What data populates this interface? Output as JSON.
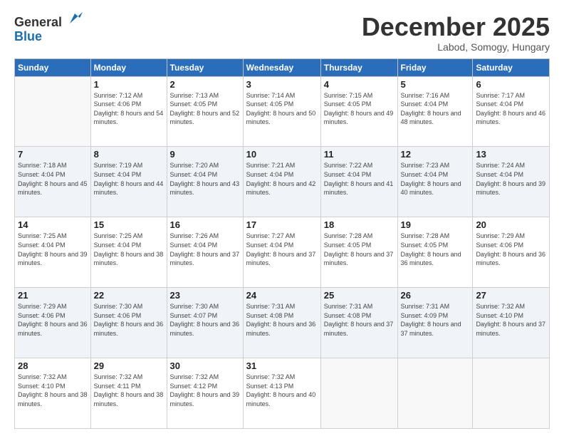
{
  "logo": {
    "general": "General",
    "blue": "Blue"
  },
  "header": {
    "month": "December 2025",
    "location": "Labod, Somogy, Hungary"
  },
  "weekdays": [
    "Sunday",
    "Monday",
    "Tuesday",
    "Wednesday",
    "Thursday",
    "Friday",
    "Saturday"
  ],
  "weeks": [
    [
      {
        "day": "",
        "sunrise": "",
        "sunset": "",
        "daylight": ""
      },
      {
        "day": "1",
        "sunrise": "Sunrise: 7:12 AM",
        "sunset": "Sunset: 4:06 PM",
        "daylight": "Daylight: 8 hours and 54 minutes."
      },
      {
        "day": "2",
        "sunrise": "Sunrise: 7:13 AM",
        "sunset": "Sunset: 4:05 PM",
        "daylight": "Daylight: 8 hours and 52 minutes."
      },
      {
        "day": "3",
        "sunrise": "Sunrise: 7:14 AM",
        "sunset": "Sunset: 4:05 PM",
        "daylight": "Daylight: 8 hours and 50 minutes."
      },
      {
        "day": "4",
        "sunrise": "Sunrise: 7:15 AM",
        "sunset": "Sunset: 4:05 PM",
        "daylight": "Daylight: 8 hours and 49 minutes."
      },
      {
        "day": "5",
        "sunrise": "Sunrise: 7:16 AM",
        "sunset": "Sunset: 4:04 PM",
        "daylight": "Daylight: 8 hours and 48 minutes."
      },
      {
        "day": "6",
        "sunrise": "Sunrise: 7:17 AM",
        "sunset": "Sunset: 4:04 PM",
        "daylight": "Daylight: 8 hours and 46 minutes."
      }
    ],
    [
      {
        "day": "7",
        "sunrise": "Sunrise: 7:18 AM",
        "sunset": "Sunset: 4:04 PM",
        "daylight": "Daylight: 8 hours and 45 minutes."
      },
      {
        "day": "8",
        "sunrise": "Sunrise: 7:19 AM",
        "sunset": "Sunset: 4:04 PM",
        "daylight": "Daylight: 8 hours and 44 minutes."
      },
      {
        "day": "9",
        "sunrise": "Sunrise: 7:20 AM",
        "sunset": "Sunset: 4:04 PM",
        "daylight": "Daylight: 8 hours and 43 minutes."
      },
      {
        "day": "10",
        "sunrise": "Sunrise: 7:21 AM",
        "sunset": "Sunset: 4:04 PM",
        "daylight": "Daylight: 8 hours and 42 minutes."
      },
      {
        "day": "11",
        "sunrise": "Sunrise: 7:22 AM",
        "sunset": "Sunset: 4:04 PM",
        "daylight": "Daylight: 8 hours and 41 minutes."
      },
      {
        "day": "12",
        "sunrise": "Sunrise: 7:23 AM",
        "sunset": "Sunset: 4:04 PM",
        "daylight": "Daylight: 8 hours and 40 minutes."
      },
      {
        "day": "13",
        "sunrise": "Sunrise: 7:24 AM",
        "sunset": "Sunset: 4:04 PM",
        "daylight": "Daylight: 8 hours and 39 minutes."
      }
    ],
    [
      {
        "day": "14",
        "sunrise": "Sunrise: 7:25 AM",
        "sunset": "Sunset: 4:04 PM",
        "daylight": "Daylight: 8 hours and 39 minutes."
      },
      {
        "day": "15",
        "sunrise": "Sunrise: 7:25 AM",
        "sunset": "Sunset: 4:04 PM",
        "daylight": "Daylight: 8 hours and 38 minutes."
      },
      {
        "day": "16",
        "sunrise": "Sunrise: 7:26 AM",
        "sunset": "Sunset: 4:04 PM",
        "daylight": "Daylight: 8 hours and 37 minutes."
      },
      {
        "day": "17",
        "sunrise": "Sunrise: 7:27 AM",
        "sunset": "Sunset: 4:04 PM",
        "daylight": "Daylight: 8 hours and 37 minutes."
      },
      {
        "day": "18",
        "sunrise": "Sunrise: 7:28 AM",
        "sunset": "Sunset: 4:05 PM",
        "daylight": "Daylight: 8 hours and 37 minutes."
      },
      {
        "day": "19",
        "sunrise": "Sunrise: 7:28 AM",
        "sunset": "Sunset: 4:05 PM",
        "daylight": "Daylight: 8 hours and 36 minutes."
      },
      {
        "day": "20",
        "sunrise": "Sunrise: 7:29 AM",
        "sunset": "Sunset: 4:06 PM",
        "daylight": "Daylight: 8 hours and 36 minutes."
      }
    ],
    [
      {
        "day": "21",
        "sunrise": "Sunrise: 7:29 AM",
        "sunset": "Sunset: 4:06 PM",
        "daylight": "Daylight: 8 hours and 36 minutes."
      },
      {
        "day": "22",
        "sunrise": "Sunrise: 7:30 AM",
        "sunset": "Sunset: 4:06 PM",
        "daylight": "Daylight: 8 hours and 36 minutes."
      },
      {
        "day": "23",
        "sunrise": "Sunrise: 7:30 AM",
        "sunset": "Sunset: 4:07 PM",
        "daylight": "Daylight: 8 hours and 36 minutes."
      },
      {
        "day": "24",
        "sunrise": "Sunrise: 7:31 AM",
        "sunset": "Sunset: 4:08 PM",
        "daylight": "Daylight: 8 hours and 36 minutes."
      },
      {
        "day": "25",
        "sunrise": "Sunrise: 7:31 AM",
        "sunset": "Sunset: 4:08 PM",
        "daylight": "Daylight: 8 hours and 37 minutes."
      },
      {
        "day": "26",
        "sunrise": "Sunrise: 7:31 AM",
        "sunset": "Sunset: 4:09 PM",
        "daylight": "Daylight: 8 hours and 37 minutes."
      },
      {
        "day": "27",
        "sunrise": "Sunrise: 7:32 AM",
        "sunset": "Sunset: 4:10 PM",
        "daylight": "Daylight: 8 hours and 37 minutes."
      }
    ],
    [
      {
        "day": "28",
        "sunrise": "Sunrise: 7:32 AM",
        "sunset": "Sunset: 4:10 PM",
        "daylight": "Daylight: 8 hours and 38 minutes."
      },
      {
        "day": "29",
        "sunrise": "Sunrise: 7:32 AM",
        "sunset": "Sunset: 4:11 PM",
        "daylight": "Daylight: 8 hours and 38 minutes."
      },
      {
        "day": "30",
        "sunrise": "Sunrise: 7:32 AM",
        "sunset": "Sunset: 4:12 PM",
        "daylight": "Daylight: 8 hours and 39 minutes."
      },
      {
        "day": "31",
        "sunrise": "Sunrise: 7:32 AM",
        "sunset": "Sunset: 4:13 PM",
        "daylight": "Daylight: 8 hours and 40 minutes."
      },
      {
        "day": "",
        "sunrise": "",
        "sunset": "",
        "daylight": ""
      },
      {
        "day": "",
        "sunrise": "",
        "sunset": "",
        "daylight": ""
      },
      {
        "day": "",
        "sunrise": "",
        "sunset": "",
        "daylight": ""
      }
    ]
  ]
}
